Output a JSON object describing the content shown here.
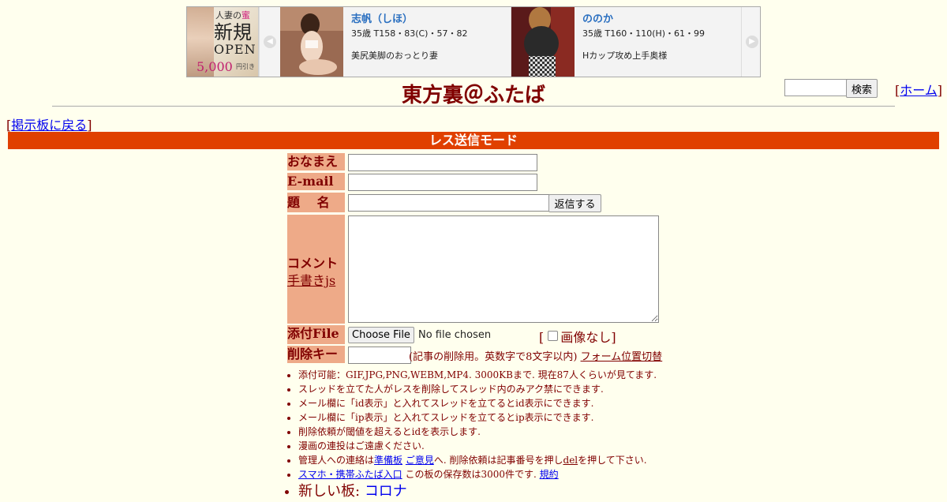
{
  "banner": {
    "left_ad": {
      "line1_prefix": "人妻の",
      "line1_highlight": "蜜",
      "line2": "新規",
      "line3": "OPEN",
      "line4": "5,000",
      "line5": "円引き"
    },
    "profiles": [
      {
        "name": "志帆（しほ）",
        "stats": "35歳 T158・83(C)・57・82",
        "desc": "美尻美脚のおっとり妻"
      },
      {
        "name": "ののか",
        "stats": "35歳 T160・110(H)・61・99",
        "desc": "Hカップ攻め上手奥様"
      }
    ]
  },
  "header": {
    "title": "東方裏＠ふたば",
    "search_button": "検索",
    "home_link": "ホーム",
    "back_link": "掲示板に戻る"
  },
  "mode_bar": "レス送信モード",
  "form": {
    "name_label": "おなまえ",
    "email_label": "E-mail",
    "subject_label": "題　 名",
    "reply_button": "返信する",
    "comment_label": "コメント",
    "handwrite_link": "手書きjs",
    "file_label": "添付File",
    "choose_file": "Choose File",
    "no_file": "No file chosen",
    "no_image_label": "画像なし]",
    "delete_key_label": "削除キー",
    "delete_note": "(記事の削除用。英数字で8文字以内)",
    "form_pos_link": "フォーム位置切替"
  },
  "notes": {
    "n1": "添付可能：GIF,JPG,PNG,WEBM,MP4. 3000KBまで. 現在87人くらいが見てます.",
    "n2": "スレッドを立てた人がレスを削除してスレッド内のみアク禁にできます.",
    "n3": "メール欄に「id表示」と入れてスレッドを立てるとid表示にできます.",
    "n4": "メール欄に「ip表示」と入れてスレッドを立てるとip表示にできます.",
    "n5": "削除依頼が閾値を超えるとidを表示します.",
    "n6": "漫画の連投はご遠慮ください.",
    "n7_prefix": "管理人への連絡は",
    "n7_link1": "準備板",
    "n7_link2": "ご意見",
    "n7_mid": "へ. 削除依頼は記事番号を押し",
    "n7_del": "del",
    "n7_suffix": "を押して下さい.",
    "n8_link": "スマホ・携帯ふたば入口",
    "n8_mid": "この板の保存数は3000件です.",
    "n8_rules": "規約",
    "n9_prefix": "新しい板:",
    "n9_link": "コロナ"
  },
  "colors": {
    "background": "#ffffee",
    "text": "#800000",
    "mode_bar": "#e04000",
    "label_bg": "#eeaa88",
    "link": "#0000ee"
  }
}
